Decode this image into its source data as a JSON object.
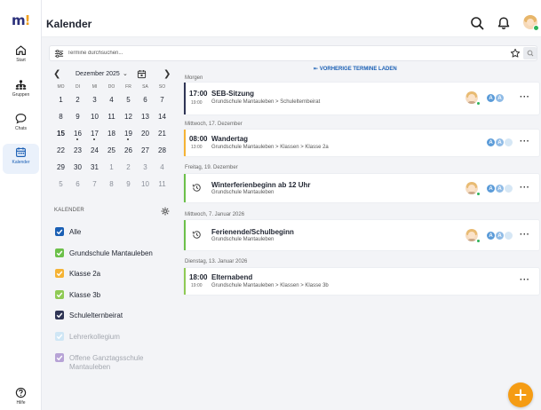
{
  "nav": {
    "items": [
      {
        "label": "Start"
      },
      {
        "label": "Gruppen"
      },
      {
        "label": "Chats"
      },
      {
        "label": "Kalender"
      }
    ],
    "help_label": "Hilfe"
  },
  "header": {
    "title": "Kalender"
  },
  "search": {
    "placeholder": "Termine durchsuchen..."
  },
  "calendar": {
    "month_label": "Dezember 2025",
    "weekdays": [
      "MO",
      "DI",
      "MI",
      "DO",
      "FR",
      "SA",
      "SO"
    ],
    "weeks": [
      [
        "1",
        "2",
        "3",
        "4",
        "5",
        "6",
        "7"
      ],
      [
        "8",
        "9",
        "10",
        "11",
        "12",
        "13",
        "14"
      ],
      [
        "15",
        "16",
        "17",
        "18",
        "19",
        "20",
        "21"
      ],
      [
        "22",
        "23",
        "24",
        "25",
        "26",
        "27",
        "28"
      ],
      [
        "29",
        "30",
        "31",
        "1",
        "2",
        "3",
        "4"
      ],
      [
        "5",
        "6",
        "7",
        "8",
        "9",
        "10",
        "11"
      ]
    ]
  },
  "calendars": {
    "section_label": "KALENDER",
    "items": [
      {
        "name": "Alle",
        "color": "#1a5fb4"
      },
      {
        "name": "Grundschule Mantauleben",
        "color": "#6cc04a"
      },
      {
        "name": "Klasse 2a",
        "color": "#f5b335"
      },
      {
        "name": "Klasse 3b",
        "color": "#8fca55"
      },
      {
        "name": "Schulelternbeirat",
        "color": "#2f3555"
      },
      {
        "name": "Lehrerkollegium",
        "color": "#cfe6f5"
      },
      {
        "name": "Offene Ganztagsschule Mantauleben",
        "color": "#b7a3d6"
      }
    ]
  },
  "events": {
    "load_previous": "VORHERIGE TERMINE LADEN",
    "groups": [
      {
        "date_label": "Morgen"
      },
      {
        "date_label": "Mittwoch, 17. Dezember"
      },
      {
        "date_label": "Freitag, 19. Dezember"
      },
      {
        "date_label": "Mittwoch, 7. Januar 2026"
      },
      {
        "date_label": "Dienstag, 13. Januar 2026"
      }
    ],
    "items": [
      {
        "start": "17:00",
        "end": "19:00",
        "title": "SEB-Sitzung",
        "path": "Grundschule Mantauleben > Schulelternbeirat",
        "color": "#2f3555"
      },
      {
        "start": "08:00",
        "end": "13:00",
        "title": "Wandertag",
        "path": "Grundschule Mantauleben > Klassen > Klasse 2a",
        "color": "#f5b335"
      },
      {
        "title": "Winterferienbeginn ab 12 Uhr",
        "path": "Grundschule Mantauleben",
        "color": "#6cc04a"
      },
      {
        "title": "Ferienende/Schulbeginn",
        "path": "Grundschule Mantauleben",
        "color": "#6cc04a"
      },
      {
        "start": "18:00",
        "end": "19:00",
        "title": "Elternabend",
        "path": "Grundschule Mantauleben > Klassen > Klasse 3b",
        "color": "#8fca55"
      }
    ]
  },
  "colors": {
    "accent": "#1a5fb4",
    "fab": "#f59c14",
    "online": "#2fb45a"
  }
}
